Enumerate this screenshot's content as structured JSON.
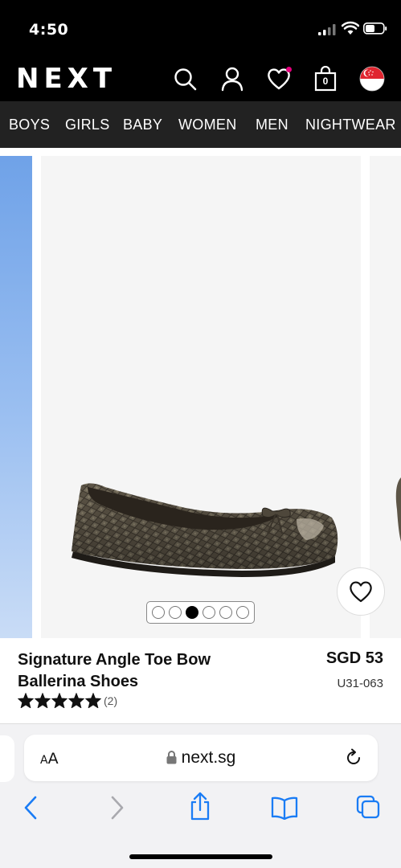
{
  "status_bar": {
    "time": "4:50"
  },
  "header": {
    "logo": "NEXT",
    "bag_count": "0",
    "icons": [
      "search-icon",
      "account-icon",
      "favourites-icon",
      "bag-icon",
      "singapore-flag-icon"
    ]
  },
  "nav": {
    "items": [
      "BOYS",
      "GIRLS",
      "BABY",
      "WOMEN",
      "MEN",
      "NIGHTWEAR"
    ]
  },
  "product": {
    "name_line1": "Signature Angle Toe Bow",
    "name_line2": "Ballerina Shoes",
    "price": "SGD 53",
    "code": "U31-063",
    "rating": 5,
    "review_count": "(2)",
    "image_count": 6,
    "active_image_index": 2
  },
  "browser": {
    "text_size_label": "AA",
    "url": "next.sg"
  },
  "colors": {
    "header_bg": "#000000",
    "nav_bg": "#222222",
    "favourite_dot": "#e4007c",
    "ios_blue": "#1a7cf5"
  }
}
